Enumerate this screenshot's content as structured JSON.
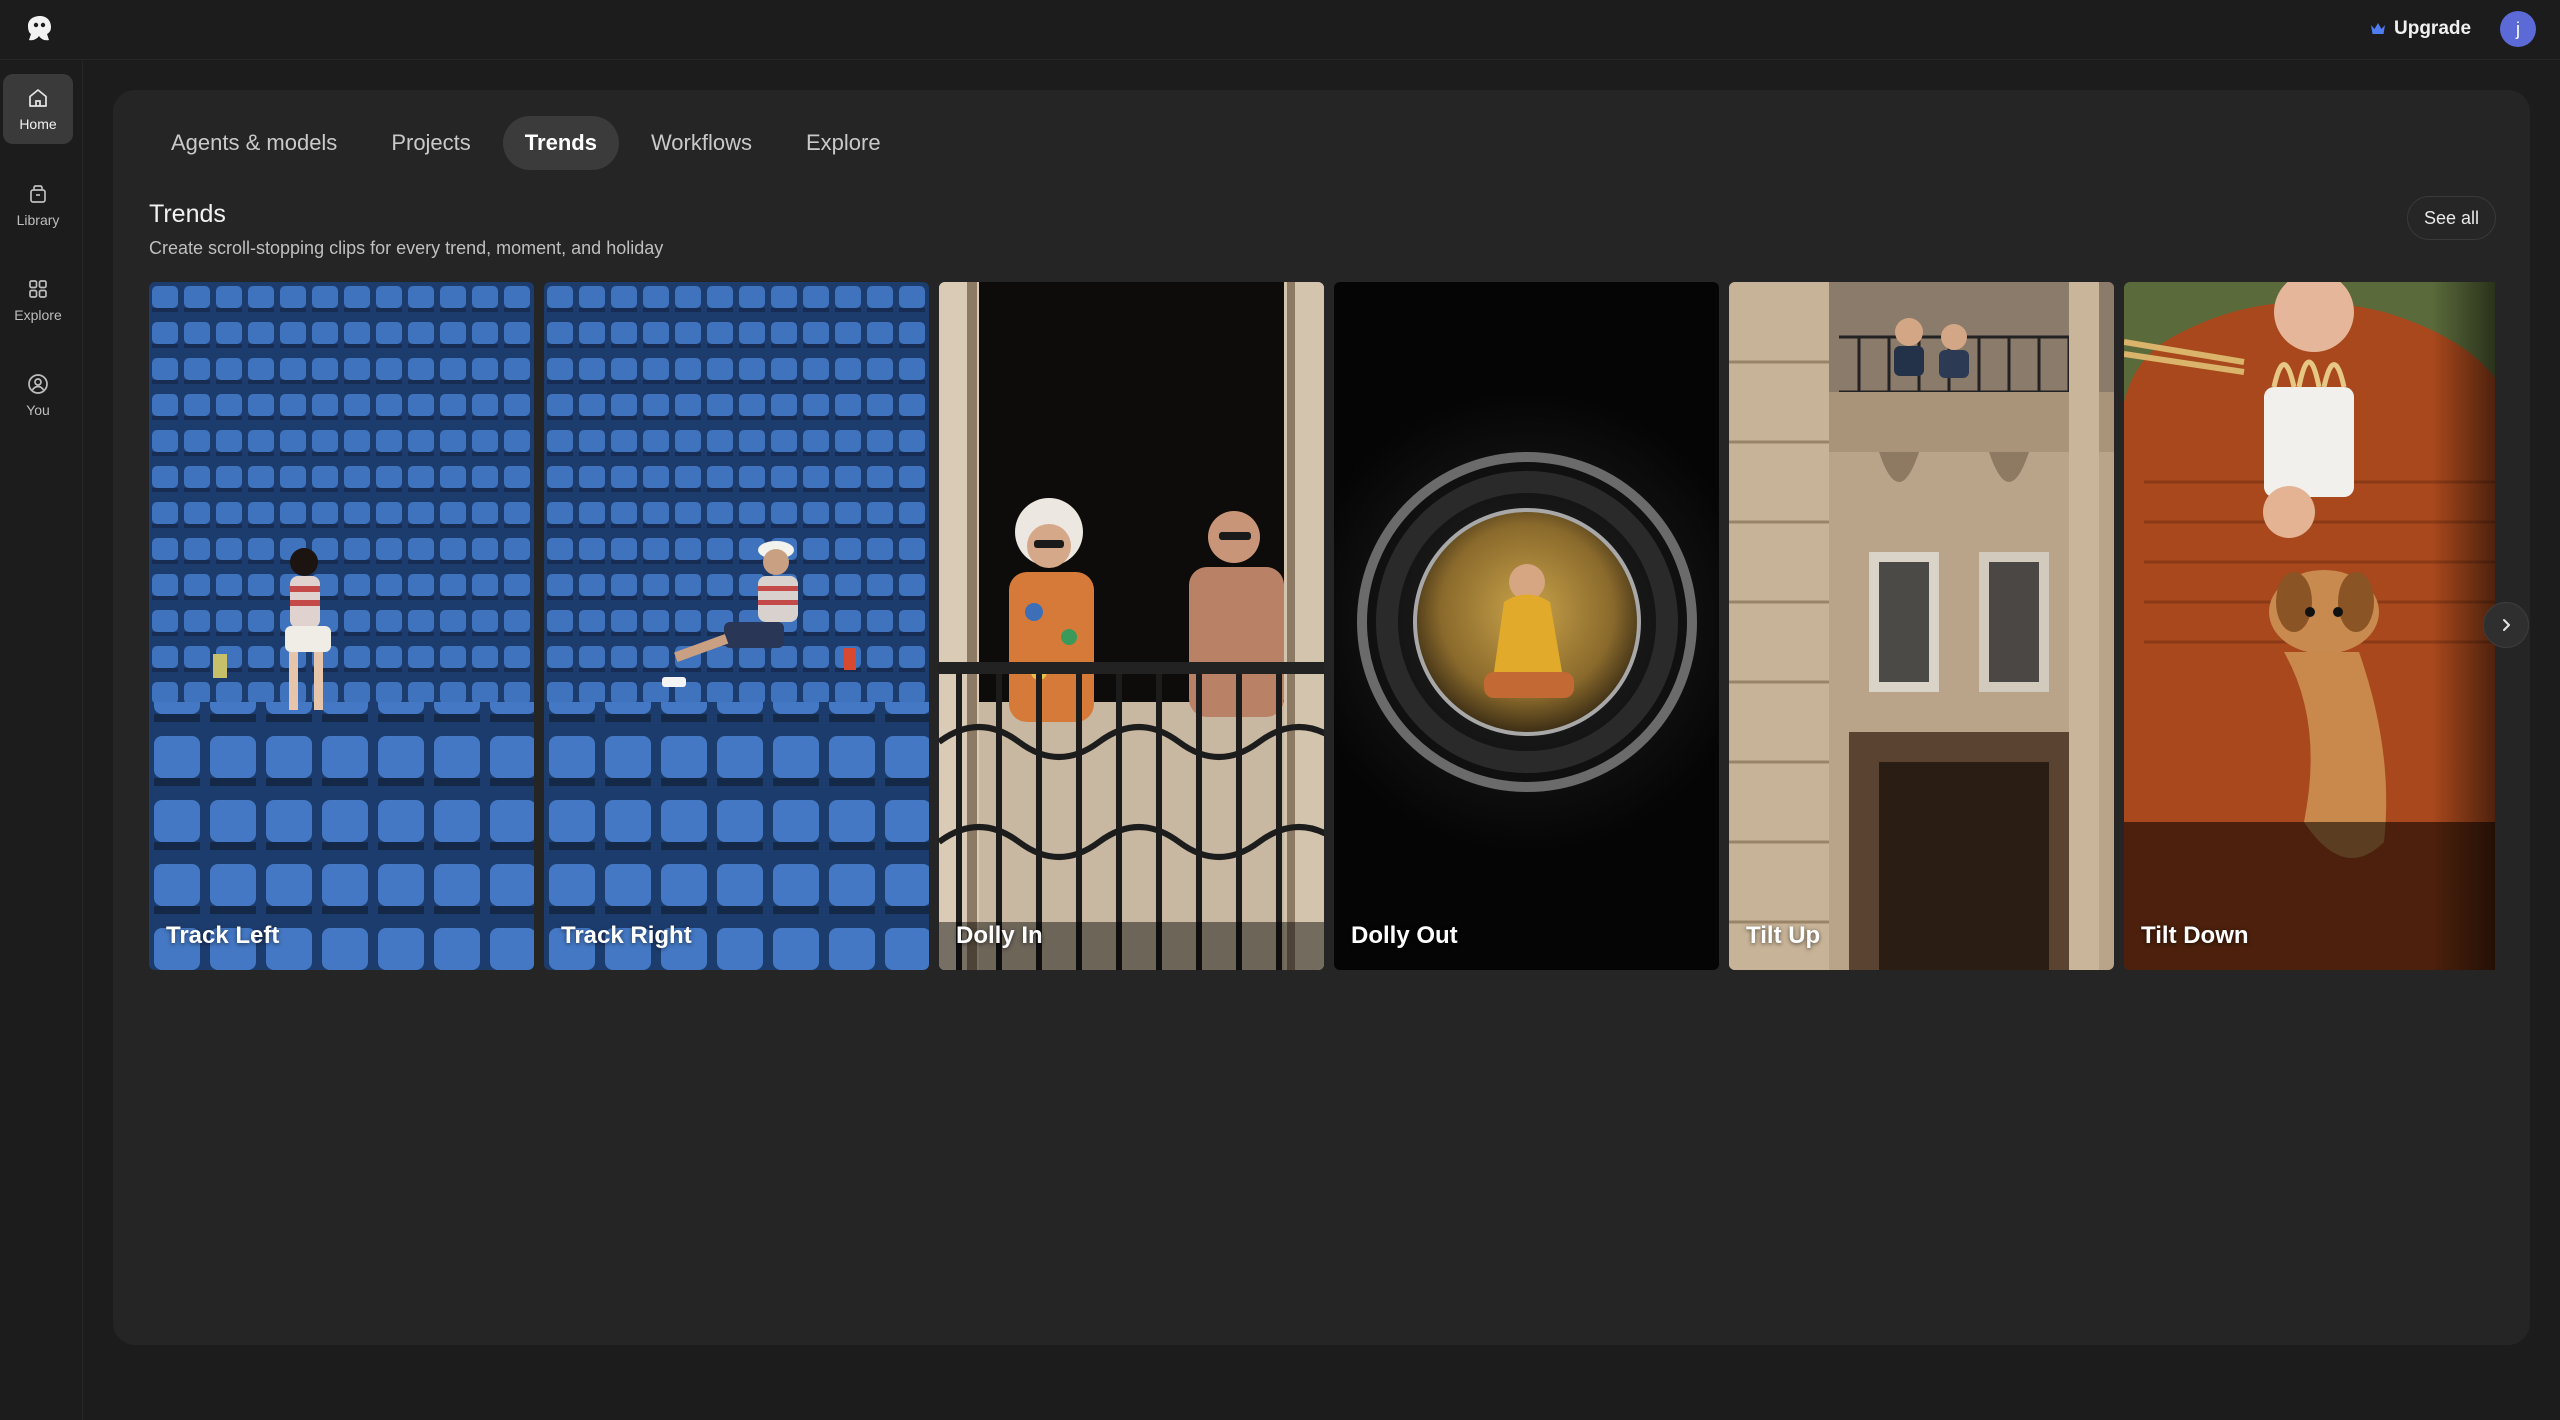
{
  "header": {
    "upgrade_label": "Upgrade",
    "avatar_initial": "j",
    "accent": "#5b6ad6",
    "crown_color": "#4f7cf0"
  },
  "sidebar": {
    "items": [
      {
        "label": "Home",
        "icon": "home-icon",
        "active": true
      },
      {
        "label": "Library",
        "icon": "library-icon",
        "active": false
      },
      {
        "label": "Explore",
        "icon": "grid-icon",
        "active": false
      },
      {
        "label": "You",
        "icon": "user-circle-icon",
        "active": false
      }
    ]
  },
  "tabs": [
    {
      "label": "Agents & models",
      "active": false
    },
    {
      "label": "Projects",
      "active": false
    },
    {
      "label": "Trends",
      "active": true
    },
    {
      "label": "Workflows",
      "active": false
    },
    {
      "label": "Explore",
      "active": false
    }
  ],
  "section": {
    "title": "Trends",
    "subtitle": "Create scroll-stopping clips for every trend, moment, and holiday",
    "see_all_label": "See all"
  },
  "cards": [
    {
      "label": "Track Left"
    },
    {
      "label": "Track Right"
    },
    {
      "label": "Dolly In"
    },
    {
      "label": "Dolly Out"
    },
    {
      "label": "Tilt Up"
    },
    {
      "label": "Tilt Down"
    }
  ]
}
